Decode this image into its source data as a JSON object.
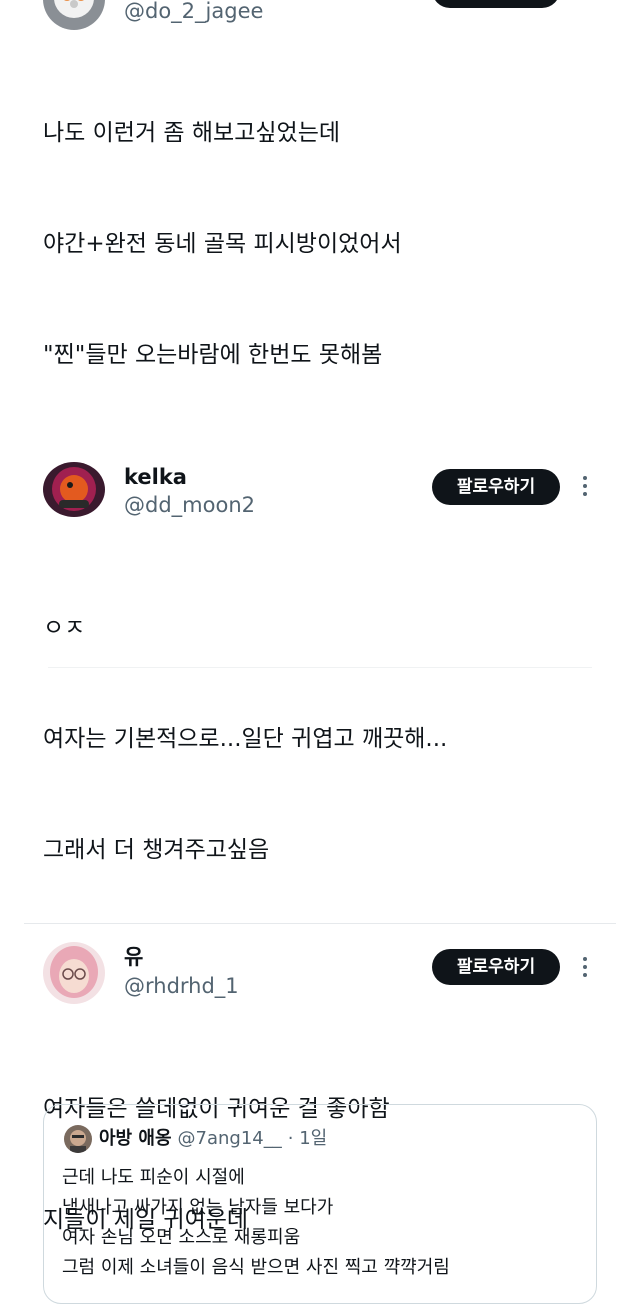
{
  "posts": [
    {
      "handle": "@do_2_jagee",
      "lines": [
        "나도 이런거 좀 해보고싶었는데",
        "야간+완전 동네 골목 피시방이었어서",
        "\"찐\"들만 오는바람에 한번도 못해봄"
      ]
    },
    {
      "name": "kelka",
      "handle": "@dd_moon2",
      "follow_label": "팔로우하기",
      "lines": [
        "ㅇㅈ",
        "여자는 기본적으로...일단 귀엽고 깨끗해...",
        "그래서 더 챙겨주고싶음"
      ]
    },
    {
      "name": "유",
      "handle": "@rhdrhd_1",
      "follow_label": "팔로우하기",
      "lines": [
        "여자들은 쓸데없이 귀여운 걸 좋아함",
        "지들이 제일 귀여운데"
      ],
      "quote": {
        "name": "아방 애옹",
        "handle": "@7ang14__",
        "time": "· 1일",
        "lines": [
          "근데 나도 피순이 시절에",
          "냄새나고 싸가지 없는 남자들 보다가",
          "여자 손님 오면 소스로 재롱피움",
          "그럼 이제 소녀들이 음식 받으면 사진 찍고 꺅꺅거림"
        ]
      }
    }
  ],
  "icons": {
    "more": "more-dots-icon"
  },
  "colors": {
    "text": "#0f1419",
    "secondary": "#536471",
    "follow_bg": "#0f1419",
    "border": "#cfd9de"
  }
}
